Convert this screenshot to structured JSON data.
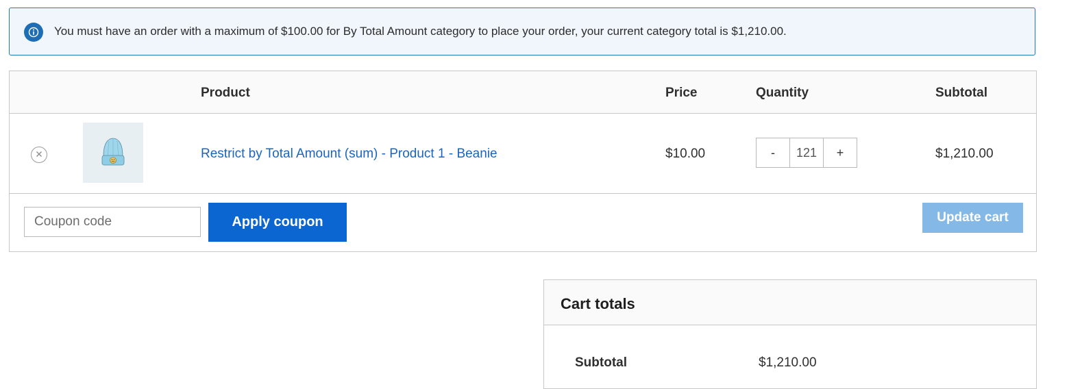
{
  "notice": {
    "icon": "info-icon",
    "text": "You must have an order with a maximum of $100.00 for By Total Amount category to place your order, your current category total is $1,210.00."
  },
  "cart_table": {
    "headers": {
      "product": "Product",
      "price": "Price",
      "quantity": "Quantity",
      "subtotal": "Subtotal"
    },
    "items": [
      {
        "remove_icon": "close-circle-icon",
        "thumbnail": "beanie-thumbnail",
        "name": "Restrict by Total Amount (sum) - Product 1 - Beanie",
        "price": "$10.00",
        "quantity": {
          "minus": "-",
          "value": "121",
          "plus": "+"
        },
        "subtotal": "$1,210.00"
      }
    ],
    "actions": {
      "coupon_placeholder": "Coupon code",
      "apply_label": "Apply coupon",
      "update_label": "Update cart"
    }
  },
  "cart_totals": {
    "title": "Cart totals",
    "rows": [
      {
        "label": "Subtotal",
        "value": "$1,210.00"
      }
    ]
  },
  "colors": {
    "notice_bg": "#f0f6fc",
    "notice_border": "#1e7cb6",
    "link": "#1a64be",
    "primary_button": "#0b66d1",
    "disabled_button": "#84b8e6"
  }
}
